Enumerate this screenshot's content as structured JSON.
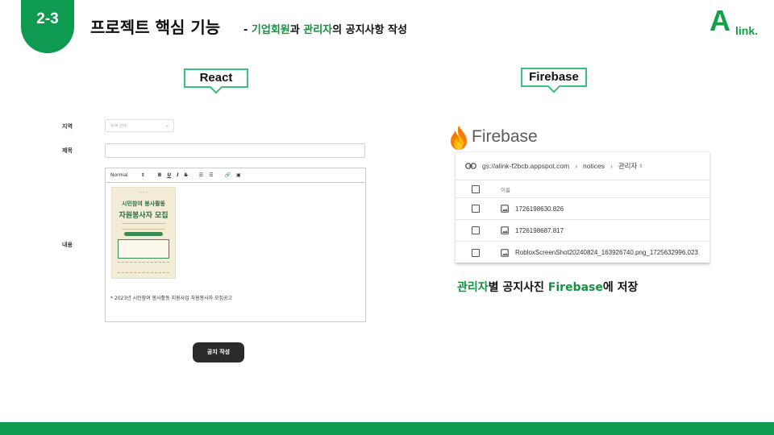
{
  "header": {
    "section_number": "2-3",
    "title": "프로젝트 핵심 기능",
    "subtitle_prefix": "- ",
    "subtitle_part1": "기업회원",
    "subtitle_part2": "과 ",
    "subtitle_part3": "관리자",
    "subtitle_part4": "의 공지사항 작성"
  },
  "logo": {
    "mark": "A",
    "text": "link."
  },
  "callouts": {
    "react": "React",
    "firebase": "Firebase"
  },
  "form": {
    "region_label": "지역",
    "region_placeholder": "지역 선택",
    "title_label": "제목",
    "content_label": "내용",
    "toolbar": {
      "format": "Normal",
      "bold": "B",
      "underline": "U",
      "italic": "I",
      "strike": "S"
    },
    "poster": {
      "title1": "시민참여 봉사활동",
      "title2": "자원봉사자 모집"
    },
    "editor_text": "* 2023년 시민참여 봉사활동 지원사업 자원봉사자 모집공고",
    "submit_label": "공지 작성"
  },
  "firebase": {
    "brand": "Firebase",
    "path": {
      "bucket": "gs://alink-f2bcb.appspot.com",
      "folder": "notices",
      "current": "관리자"
    },
    "column_name": "이름",
    "files": [
      {
        "name": "1726198630.826"
      },
      {
        "name": "1726198687.817"
      },
      {
        "name": "RobloxScreenShot20240824_163926740.png_1725632996.023"
      }
    ]
  },
  "caption": {
    "part1": "관리자",
    "part2": "별 공지사진 ",
    "part3": "Firebase",
    "part4": "에 저장"
  },
  "colors": {
    "accent": "#0e9b4f",
    "callout_border": "#3cbf78",
    "button": "#2b2b2b"
  }
}
